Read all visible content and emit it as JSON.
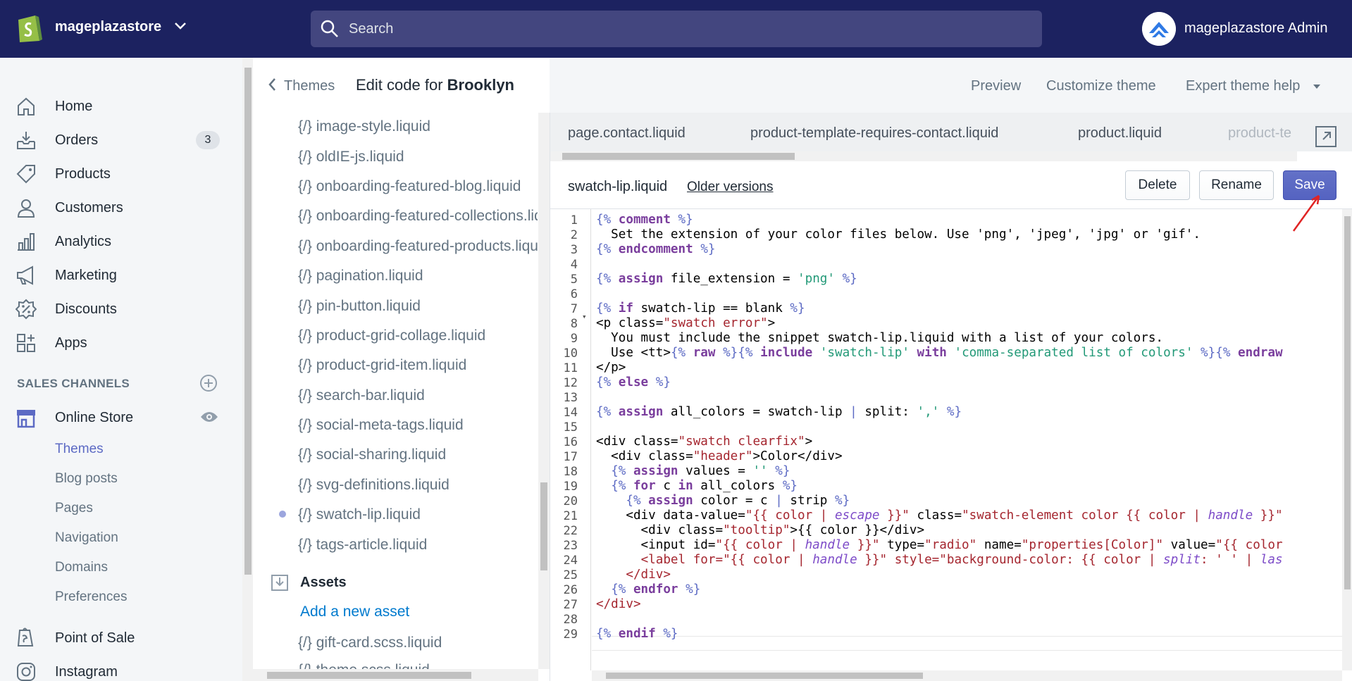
{
  "topbar": {
    "store_name": "mageplazastore",
    "search_placeholder": "Search",
    "admin_name": "mageplazastore Admin"
  },
  "sidebar": {
    "items": [
      {
        "label": "Home",
        "icon": "home-icon"
      },
      {
        "label": "Orders",
        "icon": "orders-icon",
        "badge": "3"
      },
      {
        "label": "Products",
        "icon": "tag-icon"
      },
      {
        "label": "Customers",
        "icon": "person-icon"
      },
      {
        "label": "Analytics",
        "icon": "bar-chart-icon"
      },
      {
        "label": "Marketing",
        "icon": "megaphone-icon"
      },
      {
        "label": "Discounts",
        "icon": "discount-icon"
      },
      {
        "label": "Apps",
        "icon": "apps-icon"
      }
    ],
    "sales_channels_label": "SALES CHANNELS",
    "online_store": "Online Store",
    "sub_items": [
      "Themes",
      "Blog posts",
      "Pages",
      "Navigation",
      "Domains",
      "Preferences"
    ],
    "point_of_sale": "Point of Sale",
    "instagram": "Instagram"
  },
  "header": {
    "breadcrumb": "Themes",
    "title_prefix": "Edit code for",
    "theme_name": "Brooklyn",
    "preview": "Preview",
    "customize": "Customize theme",
    "help": "Expert theme help"
  },
  "files": [
    "image-style.liquid",
    "oldIE-js.liquid",
    "onboarding-featured-blog.liquid",
    "onboarding-featured-collections.liquid",
    "onboarding-featured-products.liquid",
    "pagination.liquid",
    "pin-button.liquid",
    "product-grid-collage.liquid",
    "product-grid-item.liquid",
    "search-bar.liquid",
    "social-meta-tags.liquid",
    "social-sharing.liquid",
    "svg-definitions.liquid",
    "swatch-lip.liquid",
    "tags-article.liquid"
  ],
  "file_icon": "{/}",
  "assets": {
    "heading": "Assets",
    "add_label": "Add a new asset",
    "files": [
      "gift-card.scss.liquid",
      "theme.scss.liquid"
    ]
  },
  "tabs": [
    "page.contact.liquid",
    "product-template-requires-contact.liquid",
    "product.liquid",
    "product-te"
  ],
  "editor": {
    "filename": "swatch-lip.liquid",
    "older_versions": "Older versions",
    "delete": "Delete",
    "rename": "Rename",
    "save": "Save"
  },
  "line_numbers": [
    "1",
    "2",
    "3",
    "4",
    "5",
    "6",
    "7",
    "8",
    "9",
    "10",
    "11",
    "12",
    "13",
    "14",
    "15",
    "16",
    "17",
    "18",
    "19",
    "20",
    "21",
    "22",
    "23",
    "24",
    "25",
    "26",
    "27",
    "28",
    "29"
  ]
}
